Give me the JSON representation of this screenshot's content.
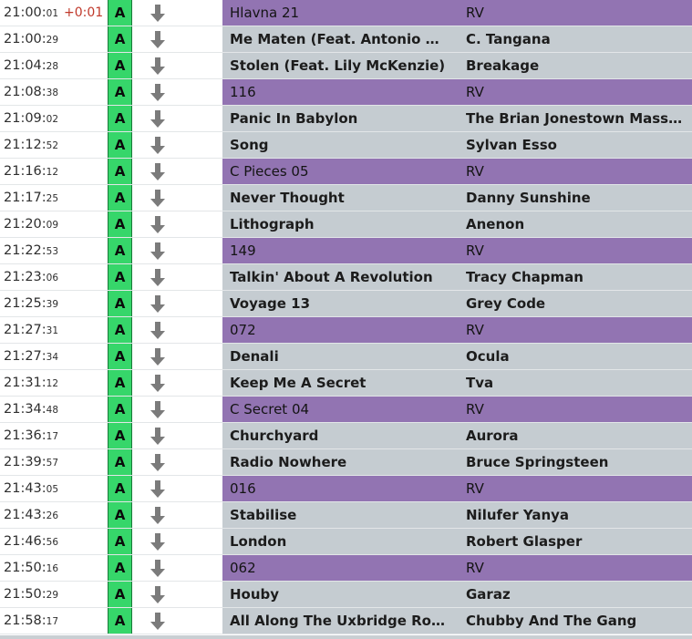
{
  "rows": [
    {
      "time_main": "21:00:",
      "time_sec": "01",
      "offset": "+0:01",
      "badge": "A",
      "title": "Hlavna 21",
      "artist": "RV",
      "type": "break"
    },
    {
      "time_main": "21:00:",
      "time_sec": "29",
      "offset": "",
      "badge": "A",
      "title": "Me Maten (Feat. Antonio Ca...",
      "artist": "C. Tangana",
      "type": "song"
    },
    {
      "time_main": "21:04:",
      "time_sec": "28",
      "offset": "",
      "badge": "A",
      "title": "Stolen (Feat. Lily McKenzie)",
      "artist": "Breakage",
      "type": "song"
    },
    {
      "time_main": "21:08:",
      "time_sec": "38",
      "offset": "",
      "badge": "A",
      "title": "116",
      "artist": "RV",
      "type": "break"
    },
    {
      "time_main": "21:09:",
      "time_sec": "02",
      "offset": "",
      "badge": "A",
      "title": "Panic In Babylon",
      "artist": "The Brian Jonestown Massac...",
      "type": "song"
    },
    {
      "time_main": "21:12:",
      "time_sec": "52",
      "offset": "",
      "badge": "A",
      "title": "Song",
      "artist": "Sylvan Esso",
      "type": "song"
    },
    {
      "time_main": "21:16:",
      "time_sec": "12",
      "offset": "",
      "badge": "A",
      "title": "C Pieces 05",
      "artist": "RV",
      "type": "break"
    },
    {
      "time_main": "21:17:",
      "time_sec": "25",
      "offset": "",
      "badge": "A",
      "title": "Never Thought",
      "artist": "Danny Sunshine",
      "type": "song"
    },
    {
      "time_main": "21:20:",
      "time_sec": "09",
      "offset": "",
      "badge": "A",
      "title": "Lithograph",
      "artist": "Anenon",
      "type": "song"
    },
    {
      "time_main": "21:22:",
      "time_sec": "53",
      "offset": "",
      "badge": "A",
      "title": "149",
      "artist": "RV",
      "type": "break"
    },
    {
      "time_main": "21:23:",
      "time_sec": "06",
      "offset": "",
      "badge": "A",
      "title": "Talkin' About A Revolution",
      "artist": "Tracy Chapman",
      "type": "song"
    },
    {
      "time_main": "21:25:",
      "time_sec": "39",
      "offset": "",
      "badge": "A",
      "title": "Voyage 13",
      "artist": "Grey Code",
      "type": "song"
    },
    {
      "time_main": "21:27:",
      "time_sec": "31",
      "offset": "",
      "badge": "A",
      "title": "072",
      "artist": "RV",
      "type": "break"
    },
    {
      "time_main": "21:27:",
      "time_sec": "34",
      "offset": "",
      "badge": "A",
      "title": "Denali",
      "artist": "Ocula",
      "type": "song"
    },
    {
      "time_main": "21:31:",
      "time_sec": "12",
      "offset": "",
      "badge": "A",
      "title": "Keep Me A Secret",
      "artist": "Tva",
      "type": "song"
    },
    {
      "time_main": "21:34:",
      "time_sec": "48",
      "offset": "",
      "badge": "A",
      "title": "C Secret 04",
      "artist": "RV",
      "type": "break"
    },
    {
      "time_main": "21:36:",
      "time_sec": "17",
      "offset": "",
      "badge": "A",
      "title": "Churchyard",
      "artist": "Aurora",
      "type": "song"
    },
    {
      "time_main": "21:39:",
      "time_sec": "57",
      "offset": "",
      "badge": "A",
      "title": "Radio Nowhere",
      "artist": "Bruce Springsteen",
      "type": "song"
    },
    {
      "time_main": "21:43:",
      "time_sec": "05",
      "offset": "",
      "badge": "A",
      "title": "016",
      "artist": "RV",
      "type": "break"
    },
    {
      "time_main": "21:43:",
      "time_sec": "26",
      "offset": "",
      "badge": "A",
      "title": "Stabilise",
      "artist": "Nilufer Yanya",
      "type": "song"
    },
    {
      "time_main": "21:46:",
      "time_sec": "56",
      "offset": "",
      "badge": "A",
      "title": "London",
      "artist": "Robert Glasper",
      "type": "song"
    },
    {
      "time_main": "21:50:",
      "time_sec": "16",
      "offset": "",
      "badge": "A",
      "title": "062",
      "artist": "RV",
      "type": "break"
    },
    {
      "time_main": "21:50:",
      "time_sec": "29",
      "offset": "",
      "badge": "A",
      "title": "Houby",
      "artist": "Garaz",
      "type": "song"
    },
    {
      "time_main": "21:58:",
      "time_sec": "17",
      "offset": "",
      "badge": "A",
      "title": "All Along The Uxbridge Road",
      "artist": "Chubby And The Gang",
      "type": "song"
    }
  ],
  "colors": {
    "song_row": "#c5ccd1",
    "break_row": "#9274b2",
    "badge": "#36d66a",
    "offset_text": "#c0392b",
    "arrow": "#7b7b7b"
  },
  "icons": {
    "move_down": "arrow-down-icon"
  }
}
